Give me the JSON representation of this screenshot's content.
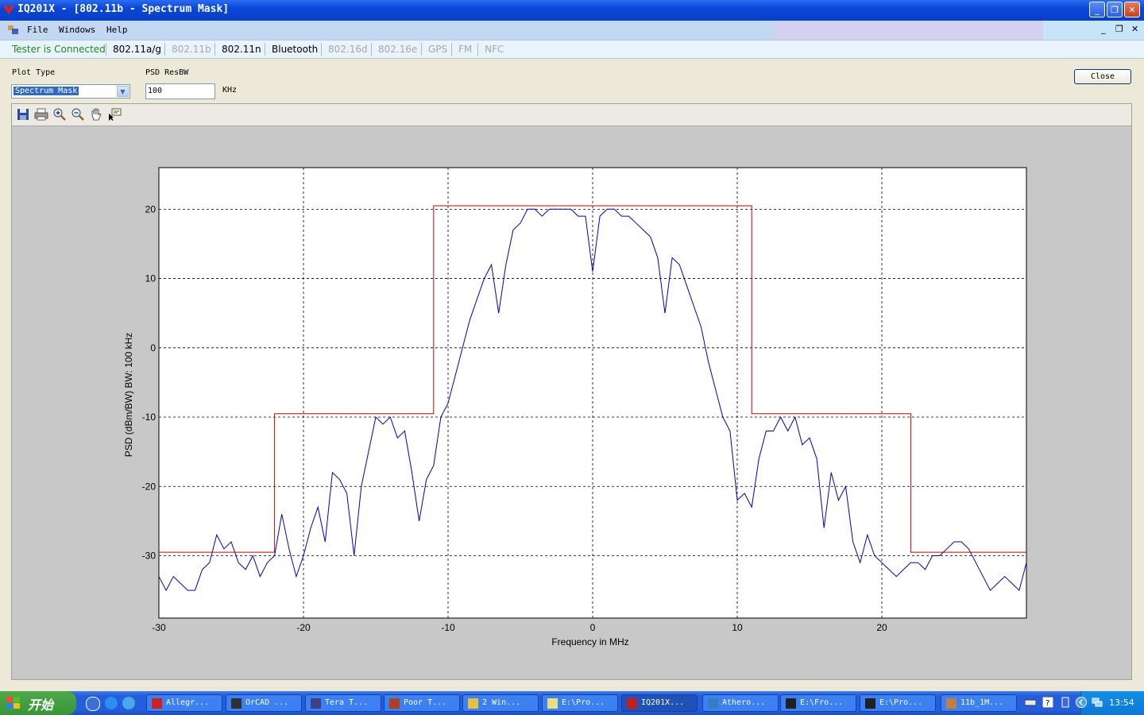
{
  "window": {
    "title": "IQ201X - [802.11b - Spectrum Mask]",
    "minimize_glyph": "_",
    "restore_glyph": "❐",
    "close_glyph": "✕"
  },
  "menu": {
    "items": [
      "File",
      "Windows",
      "Help"
    ],
    "mdi_minimize": "_",
    "mdi_restore": "❐",
    "mdi_close": "✕"
  },
  "tabs": {
    "status": "Tester is Connected",
    "items": [
      {
        "label": "802.11a/g",
        "enabled": true
      },
      {
        "label": "802.11b",
        "enabled": false
      },
      {
        "label": "802.11n",
        "enabled": true
      },
      {
        "label": "Bluetooth",
        "enabled": true
      },
      {
        "label": "802.16d",
        "enabled": false
      },
      {
        "label": "802.16e",
        "enabled": false
      },
      {
        "label": "GPS",
        "enabled": false
      },
      {
        "label": "FM",
        "enabled": false
      },
      {
        "label": "NFC",
        "enabled": false
      }
    ]
  },
  "controls": {
    "plot_type_label": "Plot Type",
    "plot_type_value": "Spectrum Mask",
    "psd_label": "PSD ResBW",
    "psd_value": "100",
    "psd_unit": "KHz",
    "close_label": "Close"
  },
  "toolbar_icons": [
    "save-icon",
    "print-icon",
    "zoom-in-icon",
    "zoom-out-icon",
    "pan-hand-icon",
    "data-cursor-icon"
  ],
  "chart_data": {
    "type": "line",
    "title": "",
    "xlabel": "Frequency in MHz",
    "ylabel": "PSD (dBm/BW) BW: 100 kHz",
    "xlim": [
      -30,
      30
    ],
    "ylim": [
      -39,
      26
    ],
    "xticks": [
      -30,
      -20,
      -10,
      0,
      10,
      20
    ],
    "yticks": [
      -30,
      -20,
      -10,
      0,
      10,
      20
    ],
    "grid": true,
    "series": [
      {
        "color": "#0000c0",
        "x": [
          -30,
          -29.5,
          -29,
          -28.5,
          -28,
          -27.5,
          -27,
          -26.5,
          -26,
          -25.5,
          -25,
          -24.5,
          -24,
          -23.5,
          -23,
          -22.5,
          -22,
          -21.5,
          -21,
          -20.5,
          -20,
          -19.5,
          -19,
          -18.5,
          -18,
          -17.5,
          -17,
          -16.5,
          -16,
          -15.5,
          -15,
          -14.5,
          -14,
          -13.5,
          -13,
          -12.5,
          -12,
          -11.5,
          -11,
          -10.5,
          -10,
          -9.5,
          -9,
          -8.5,
          -8,
          -7.5,
          -7,
          -6.5,
          -6,
          -5.5,
          -5,
          -4.5,
          -4,
          -3.5,
          -3,
          -2.5,
          -2,
          -1.5,
          -1,
          -0.5,
          0,
          0.5,
          1,
          1.5,
          2,
          2.5,
          3,
          3.5,
          4,
          4.5,
          5,
          5.5,
          6,
          6.5,
          7,
          7.5,
          8,
          8.5,
          9,
          9.5,
          10,
          10.5,
          11,
          11.5,
          12,
          12.5,
          13,
          13.5,
          14,
          14.5,
          15,
          15.5,
          16,
          16.5,
          17,
          17.5,
          18,
          18.5,
          19,
          19.5,
          20,
          20.5,
          21,
          21.5,
          22,
          22.5,
          23,
          23.5,
          24,
          24.5,
          25,
          25.5,
          26,
          26.5,
          27,
          27.5,
          28,
          28.5,
          29,
          29.5,
          30
        ],
        "y": [
          -33,
          -35,
          -33,
          -34,
          -35,
          -35,
          -32,
          -31,
          -27,
          -29,
          -28,
          -31,
          -32,
          -30,
          -33,
          -31,
          -30,
          -24,
          -29,
          -33,
          -30,
          -26,
          -23,
          -28,
          -18,
          -19,
          -21,
          -30,
          -20,
          -15,
          -10,
          -11,
          -10,
          -13,
          -12,
          -18,
          -25,
          -19,
          -17,
          -10,
          -8,
          -4,
          0,
          4,
          7,
          10,
          12,
          5,
          12,
          17,
          18,
          20,
          20,
          19,
          20,
          20,
          20,
          20,
          19,
          19,
          11,
          19,
          20,
          20,
          19,
          19,
          18,
          17,
          16,
          13,
          5,
          13,
          12,
          9,
          6,
          3,
          -2,
          -6,
          -10,
          -12,
          -22,
          -21,
          -23,
          -16,
          -12,
          -12,
          -10,
          -12,
          -10,
          -14,
          -13,
          -16,
          -26,
          -18,
          -22,
          -20,
          -28,
          -31,
          -27,
          -30,
          -31,
          -32,
          -33,
          -32,
          -31,
          -31,
          -32,
          -30,
          -30,
          -29,
          -28,
          -28,
          -29,
          -31,
          -33,
          -35,
          -34,
          -33,
          -34,
          -35,
          -31
        ]
      },
      {
        "color": "#d00000",
        "x": [
          -30,
          -22,
          -22,
          -11,
          -11,
          11,
          11,
          22,
          22,
          30
        ],
        "y": [
          -29.5,
          -29.5,
          -9.5,
          -9.5,
          20.5,
          20.5,
          -9.5,
          -9.5,
          -29.5,
          -29.5
        ]
      }
    ]
  },
  "taskbar": {
    "start_label": "开始",
    "tasks": [
      {
        "label": "Allegr...",
        "icon_color": "#d02020"
      },
      {
        "label": "OrCAD ...",
        "icon_color": "#303030"
      },
      {
        "label": "Tera T...",
        "icon_color": "#404080"
      },
      {
        "label": "Poor T...",
        "icon_color": "#b04020"
      },
      {
        "label": "2 Win...",
        "icon_color": "#e8c040"
      },
      {
        "label": "E:\\Pro...",
        "icon_color": "#e8e080"
      },
      {
        "label": "IQ201X...",
        "icon_color": "#c02020"
      },
      {
        "label": "Athero...",
        "icon_color": "#3080c0"
      },
      {
        "label": "E:\\Fro...",
        "icon_color": "#202020"
      },
      {
        "label": "E:\\Pro...",
        "icon_color": "#202020"
      },
      {
        "label": "11b_1M...",
        "icon_color": "#c08040"
      }
    ],
    "clock": "13:54"
  }
}
